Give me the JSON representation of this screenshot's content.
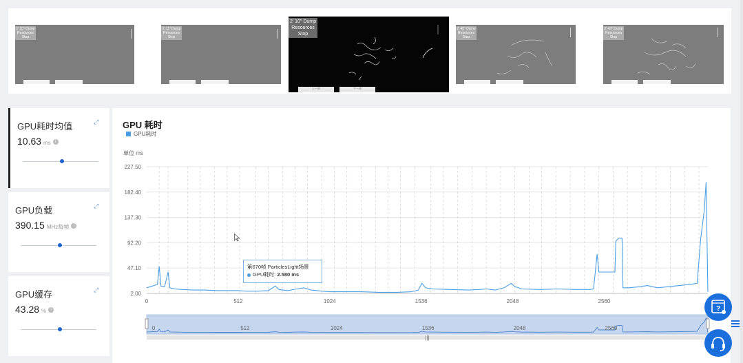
{
  "thumbnails": [
    {
      "label": "1' 10\" Dump Resources Stop",
      "active": false
    },
    {
      "label": "1' 11\" Dump Resources Stop",
      "active": false
    },
    {
      "label": "2' 10\" Dump Resources Stop",
      "active": true,
      "btn_left": "上一帧",
      "btn_right": "下一帧"
    },
    {
      "label": "2' 40\" Dump Resources Stop",
      "active": false
    },
    {
      "label": "2' 43\" Dump Resources Stop",
      "active": false
    }
  ],
  "cards": [
    {
      "title": "GPU耗时均值",
      "value": "10.63",
      "unit": "ms",
      "active": true,
      "slider": 0.5
    },
    {
      "title": "GPU负载",
      "value": "390.15",
      "unit": "MHz每帧",
      "active": false,
      "slider": 0.5
    },
    {
      "title": "GPU缓存",
      "value": "43.28",
      "unit": "%",
      "active": false,
      "slider": 0.5
    }
  ],
  "chart": {
    "title": "GPU 耗时",
    "legend": "GPU耗时",
    "unit_label": "单位    ms",
    "color": "#4a9fe4"
  },
  "chart_data": {
    "type": "line",
    "series": [
      {
        "name": "GPU耗时",
        "values": []
      }
    ],
    "y_ticks": [
      "2.00",
      "47.10",
      "92.20",
      "137.30",
      "182.40",
      "227.50"
    ],
    "x_ticks": [
      "0",
      "512",
      "1024",
      "1536",
      "2048",
      "2560"
    ],
    "ylim": [
      2.0,
      227.5
    ],
    "xlim": [
      0,
      3140
    ],
    "points": [
      [
        0,
        12
      ],
      [
        20,
        14
      ],
      [
        40,
        16
      ],
      [
        60,
        18
      ],
      [
        70,
        50
      ],
      [
        80,
        15
      ],
      [
        100,
        14
      ],
      [
        120,
        40
      ],
      [
        130,
        12
      ],
      [
        160,
        10
      ],
      [
        200,
        9
      ],
      [
        260,
        8
      ],
      [
        320,
        8
      ],
      [
        400,
        7
      ],
      [
        460,
        7
      ],
      [
        512,
        7
      ],
      [
        560,
        6
      ],
      [
        620,
        6
      ],
      [
        680,
        7
      ],
      [
        720,
        15
      ],
      [
        740,
        9
      ],
      [
        790,
        7
      ],
      [
        840,
        10
      ],
      [
        880,
        12
      ],
      [
        920,
        8
      ],
      [
        980,
        6
      ],
      [
        1024,
        5
      ],
      [
        1100,
        5
      ],
      [
        1200,
        5
      ],
      [
        1300,
        4
      ],
      [
        1400,
        4
      ],
      [
        1480,
        5
      ],
      [
        1520,
        8
      ],
      [
        1540,
        20
      ],
      [
        1560,
        12
      ],
      [
        1600,
        10
      ],
      [
        1700,
        9
      ],
      [
        1800,
        8
      ],
      [
        1860,
        9
      ],
      [
        1900,
        10
      ],
      [
        1950,
        8
      ],
      [
        2000,
        12
      ],
      [
        2040,
        20
      ],
      [
        2060,
        14
      ],
      [
        2100,
        10
      ],
      [
        2200,
        9
      ],
      [
        2300,
        10
      ],
      [
        2400,
        9
      ],
      [
        2480,
        9
      ],
      [
        2500,
        10
      ],
      [
        2510,
        40
      ],
      [
        2520,
        72
      ],
      [
        2530,
        40
      ],
      [
        2560,
        40
      ],
      [
        2600,
        40
      ],
      [
        2620,
        40
      ],
      [
        2625,
        95
      ],
      [
        2640,
        100
      ],
      [
        2660,
        100
      ],
      [
        2665,
        12
      ],
      [
        2700,
        12
      ],
      [
        2760,
        14
      ],
      [
        2800,
        16
      ],
      [
        2860,
        12
      ],
      [
        2920,
        14
      ],
      [
        2980,
        16
      ],
      [
        3040,
        18
      ],
      [
        3080,
        20
      ],
      [
        3100,
        100
      ],
      [
        3120,
        150
      ],
      [
        3130,
        200
      ],
      [
        3140,
        5
      ]
    ]
  },
  "tooltip": {
    "line1": "第670帧 ParticlesLight场景",
    "series": "GPU耗时:",
    "value": "2.580 ms"
  },
  "slider_ticks": [
    "0",
    "512",
    "1024",
    "1536",
    "2048",
    "2560"
  ]
}
